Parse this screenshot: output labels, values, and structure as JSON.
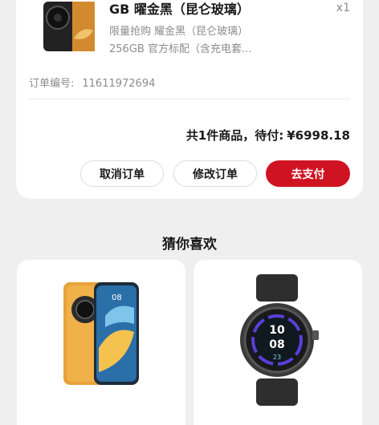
{
  "order": {
    "product_title": "GB 曜金黑（昆仑玻璃）",
    "quantity": "x1",
    "spec_line1": "限量抢购 耀金黑（昆仑玻璃）",
    "spec_line2": "256GB 官方标配（含充电套...",
    "order_number_label": "订单编号:",
    "order_number_value": "11611972694",
    "summary_prefix": "共1件商品，待付:",
    "summary_amount": "¥6998.18",
    "buttons": {
      "cancel": "取消订单",
      "modify": "修改订单",
      "pay": "去支付"
    }
  },
  "recommend": {
    "title": "猜你喜欢",
    "watch_display": [
      "10",
      "08",
      "23"
    ]
  },
  "colors": {
    "accent_red": "#cf1322",
    "page_bg": "#efefef",
    "card_bg": "#ffffff"
  }
}
